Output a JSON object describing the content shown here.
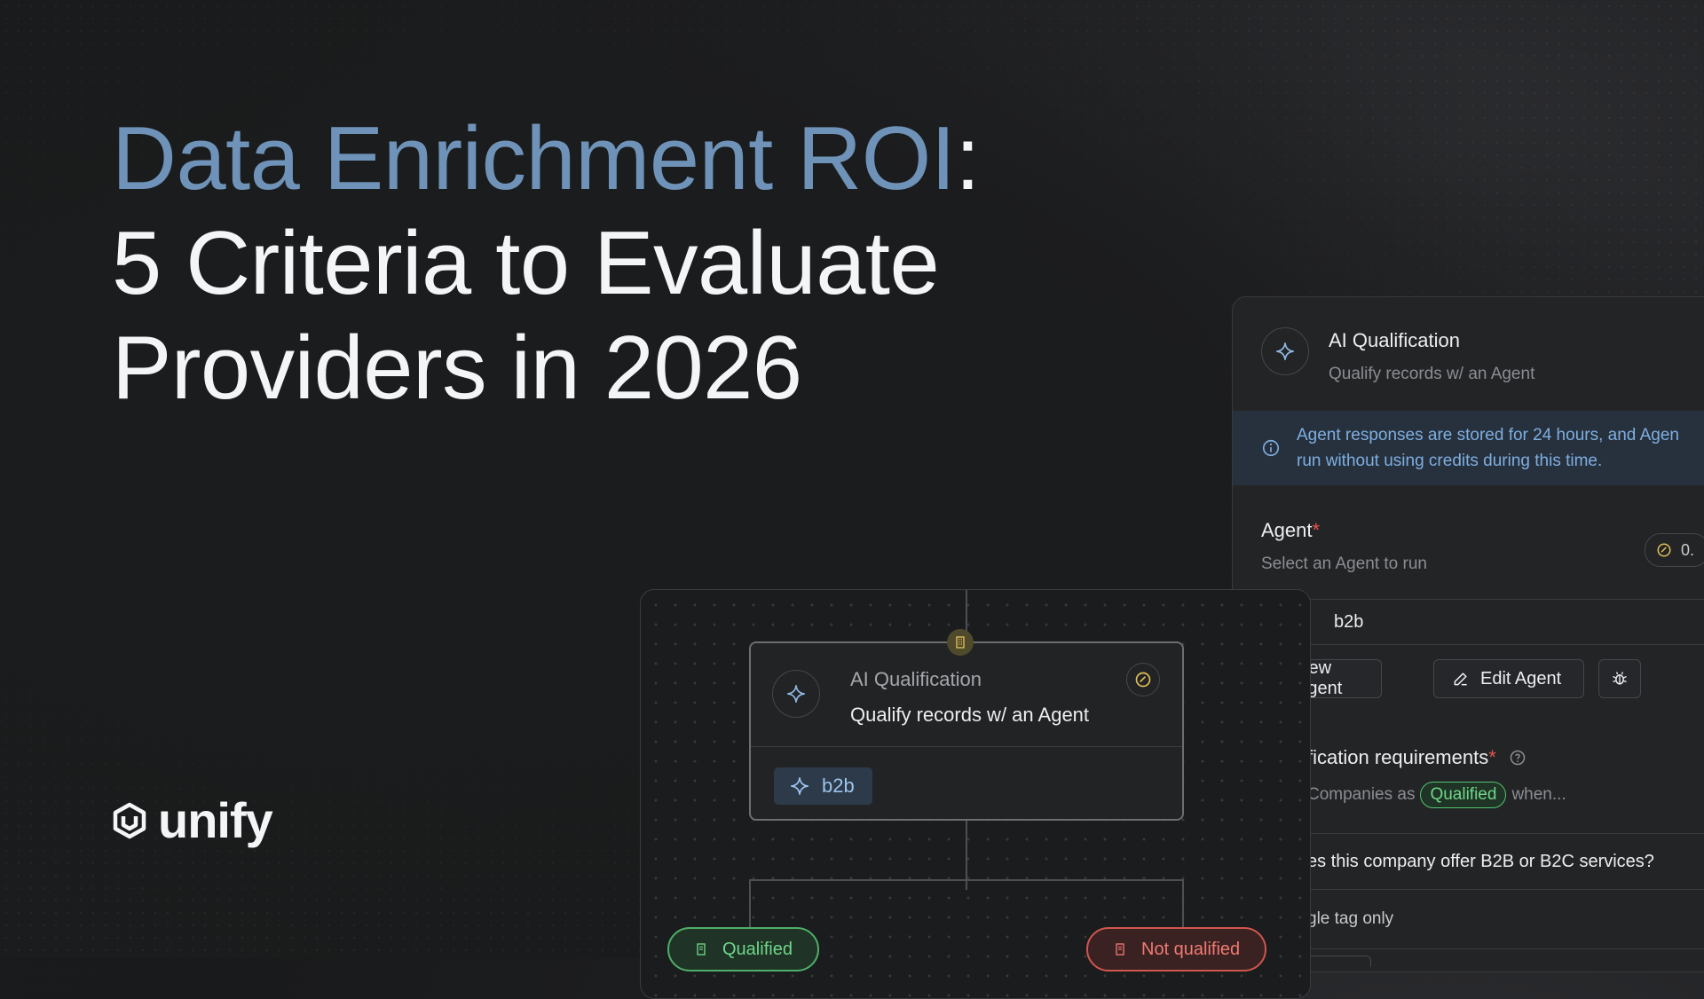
{
  "headline": {
    "accent": "Data Enrichment ROI",
    "colon": ":",
    "line2": "5 Criteria to Evaluate",
    "line3": "Providers in 2026"
  },
  "logo": {
    "text": "unify"
  },
  "side_panel": {
    "title": "AI Qualification",
    "subtitle": "Qualify records w/ an Agent",
    "info_line1": "Agent responses are stored for 24 hours, and Agen",
    "info_line2": "run without using credits during this time.",
    "agent_label": "Agent",
    "required_mark": "*",
    "agent_sub": "Select an Agent to run",
    "credit_value": "0.",
    "selected_agent": "b2b",
    "new_agent_label": "New Agent",
    "edit_agent_label": "Edit Agent",
    "req_label": "fication requirements",
    "req_prefix": "Companies as",
    "qualified_tag": "Qualified",
    "req_suffix": "when...",
    "question": "es this company offer B2B or B2C services?",
    "single_tag": "gle tag only"
  },
  "node": {
    "title": "AI Qualification",
    "subtitle": "Qualify records w/ an Agent",
    "tag": "b2b"
  },
  "branches": {
    "qualified": "Qualified",
    "not_qualified": "Not qualified"
  },
  "colors": {
    "accent_blue": "#6f93b8",
    "success_green": "#6fd788",
    "danger_red": "#f07a70",
    "info_blue": "#7eaee0"
  }
}
